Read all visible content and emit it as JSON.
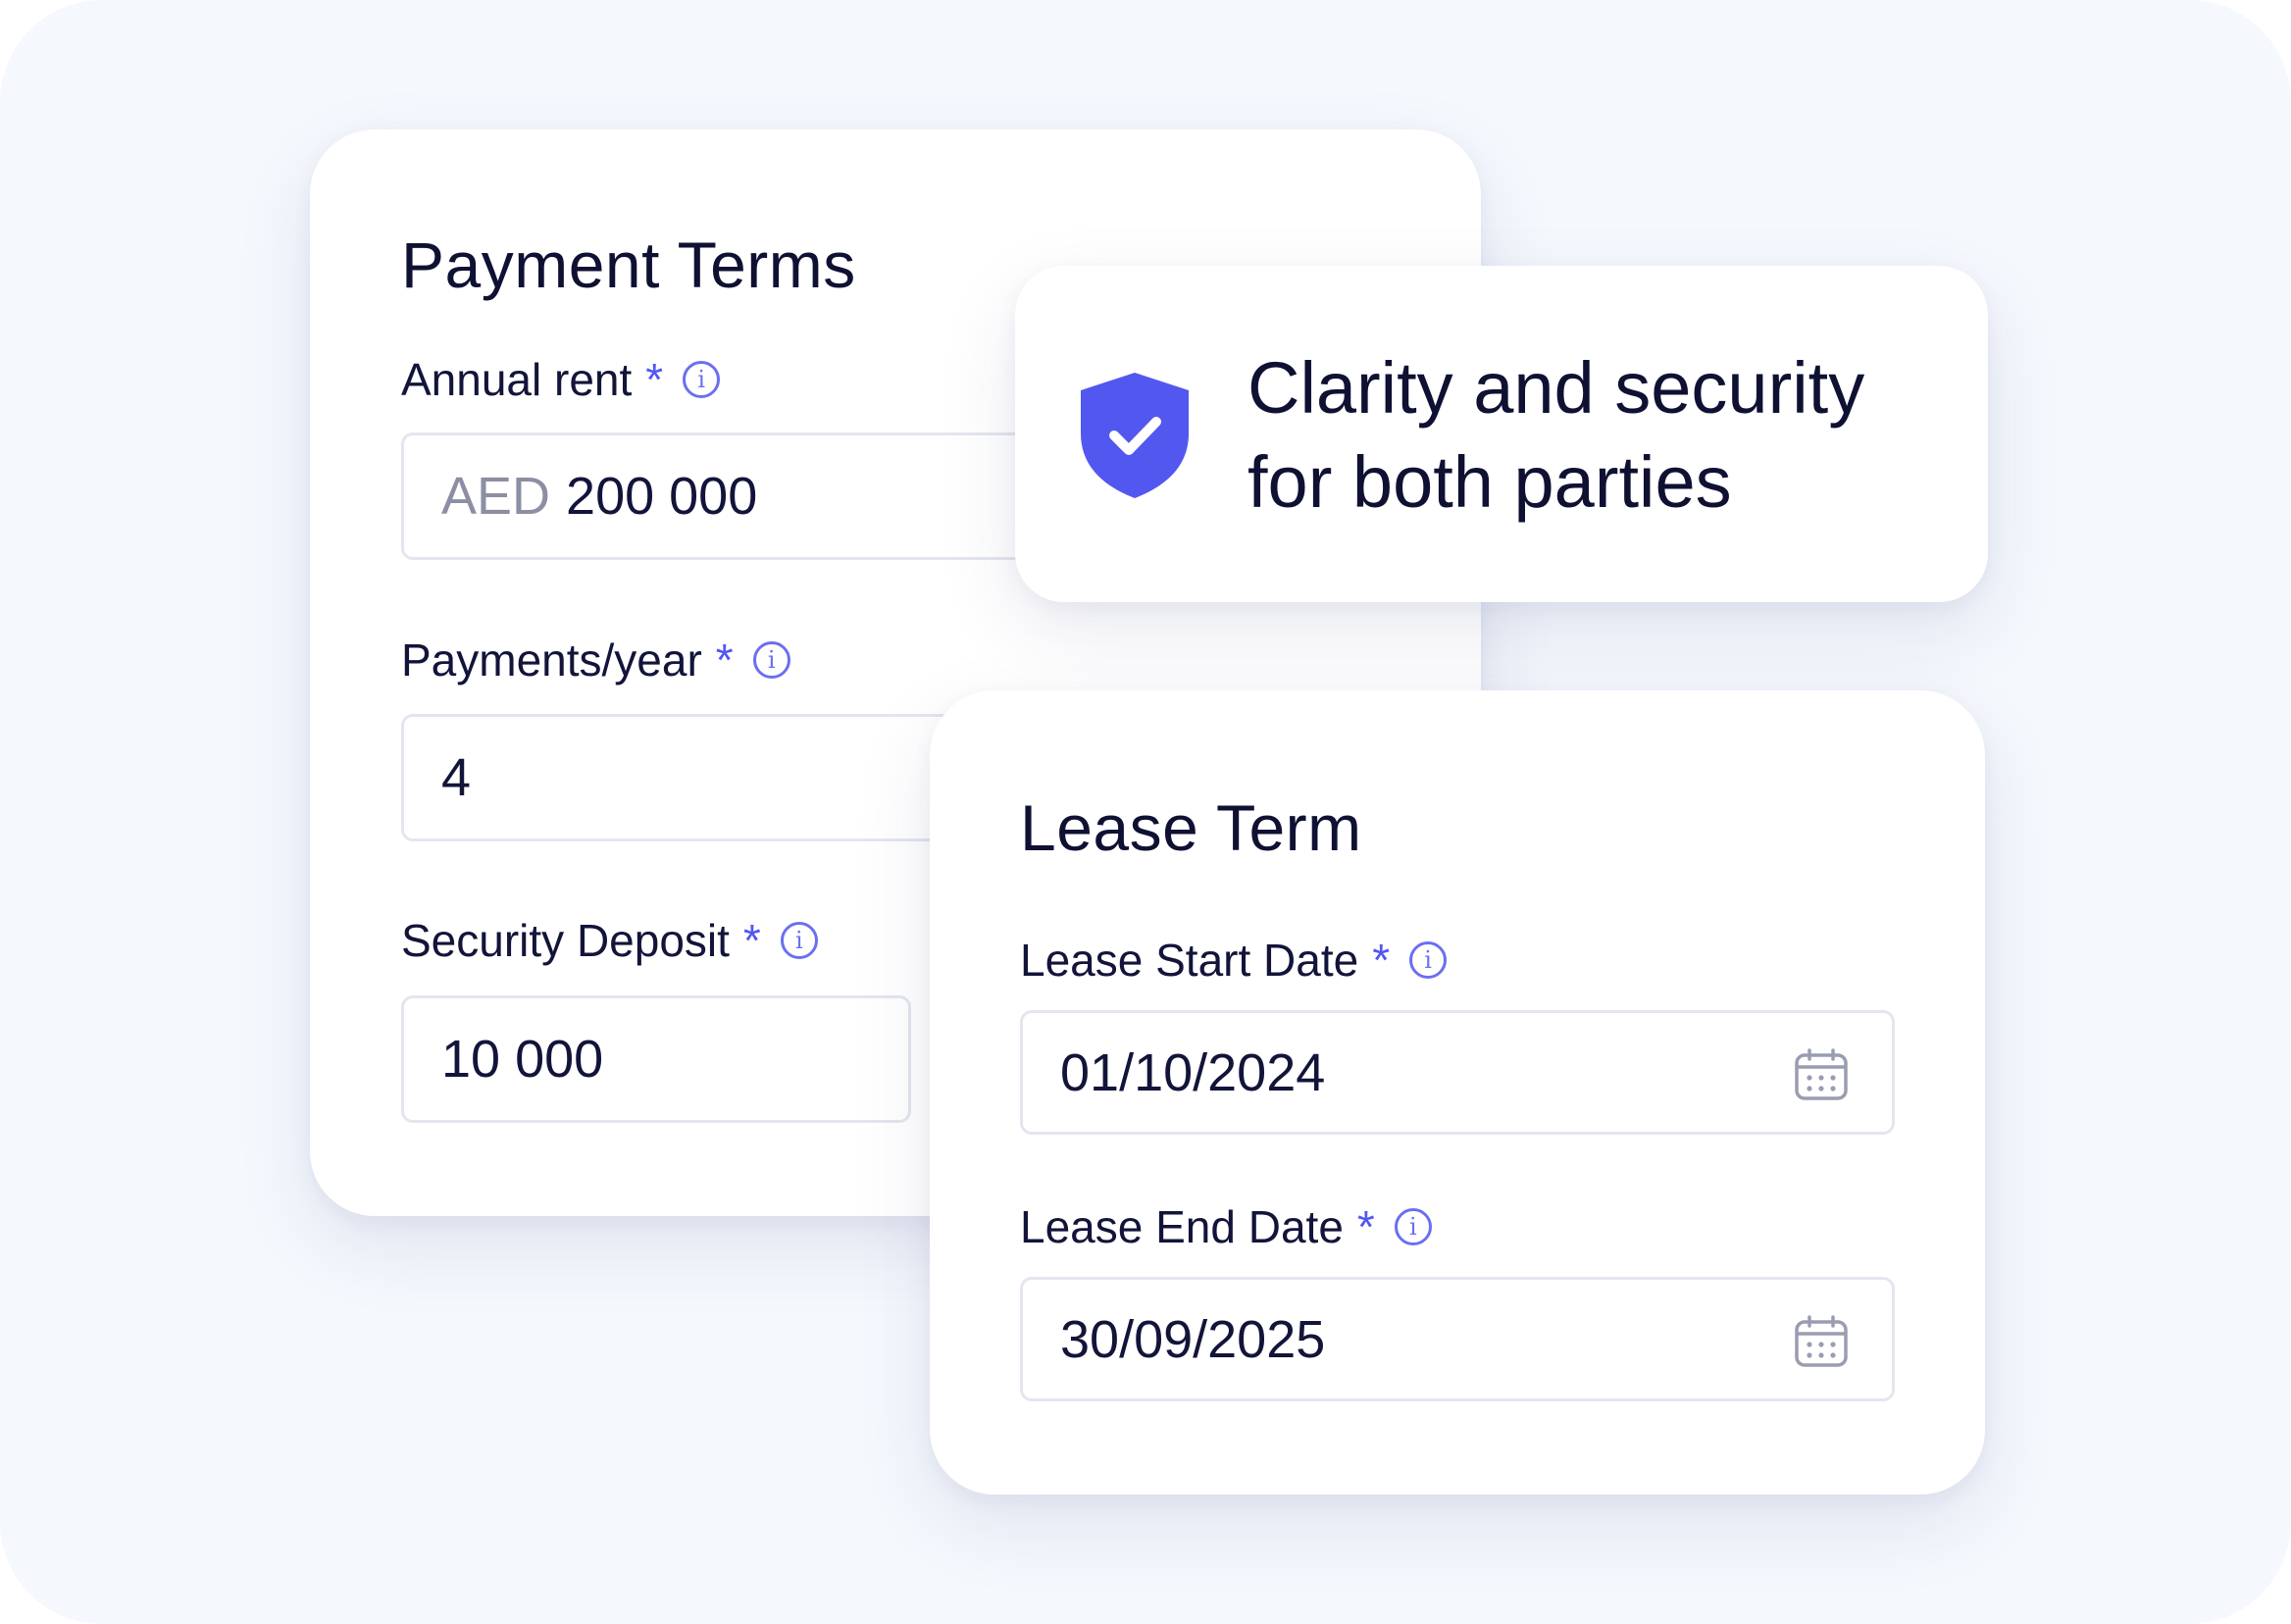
{
  "payment_terms": {
    "title": "Payment Terms",
    "annual_rent": {
      "label": "Annual rent",
      "required": "*",
      "currency": "AED",
      "value": "200 000"
    },
    "payments_per_year": {
      "label": "Payments/year",
      "required": "*",
      "value": "4"
    },
    "security_deposit": {
      "label": "Security Deposit",
      "required": "*",
      "value": "10 000"
    }
  },
  "badge": {
    "line1": "Clarity and security",
    "line2": "for both parties"
  },
  "lease_term": {
    "title": "Lease Term",
    "start_date": {
      "label": "Lease Start Date",
      "required": "*",
      "value": "01/10/2024"
    },
    "end_date": {
      "label": "Lease End Date",
      "required": "*",
      "value": "30/09/2025"
    }
  },
  "info_icon_glyph": "i",
  "colors": {
    "accent": "#5257f0",
    "background": "#f5f8fd",
    "text": "#0f1133",
    "muted": "#8c8fa3",
    "border": "#e3e6ee"
  }
}
